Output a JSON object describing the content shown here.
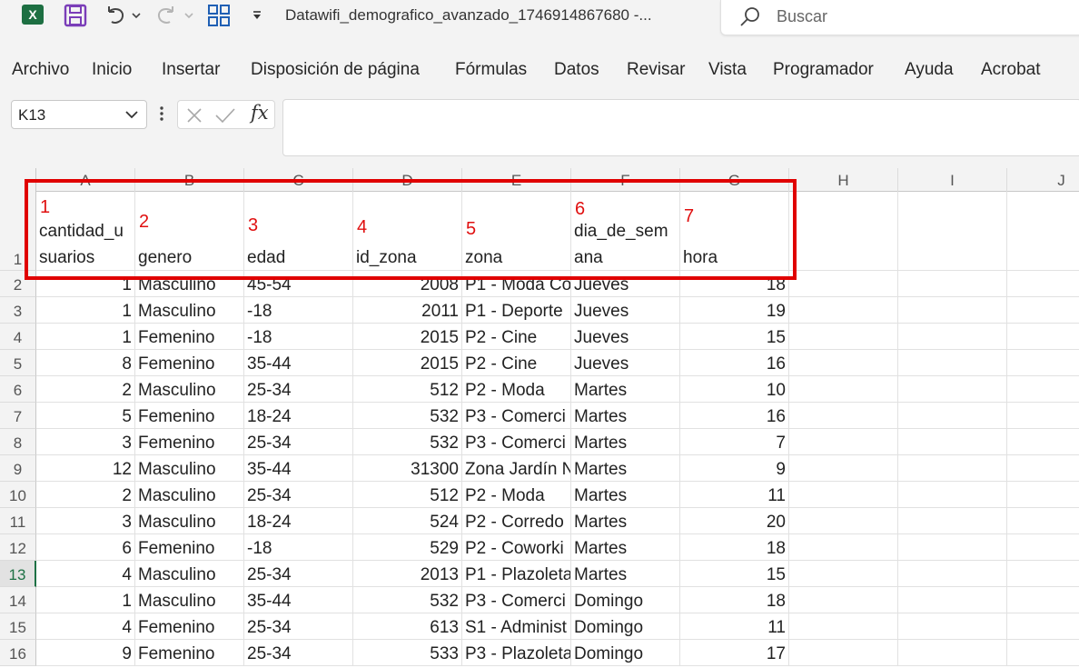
{
  "window": {
    "title": "Datawifi_demografico_avanzado_1746914867680  -...",
    "app_logo_text": "X",
    "search_placeholder": "Buscar"
  },
  "ribbon_tabs": [
    "Archivo",
    "Inicio",
    "Insertar",
    "Disposición de página",
    "Fórmulas",
    "Datos",
    "Revisar",
    "Vista",
    "Programador",
    "Ayuda",
    "Acrobat"
  ],
  "formula_bar": {
    "name_box": "K13",
    "fx_label": "fx",
    "formula": ""
  },
  "grid": {
    "columns": [
      "A",
      "B",
      "C",
      "D",
      "E",
      "F",
      "G",
      "H",
      "I",
      "J"
    ],
    "header_row": {
      "row_number": "1",
      "cells": [
        {
          "marker": "1",
          "line1": "cantidad_u",
          "line2": "suarios"
        },
        {
          "marker": "2",
          "line1": "",
          "line2": "genero"
        },
        {
          "marker": "3",
          "line1": "",
          "line2": "edad"
        },
        {
          "marker": "4",
          "line1": "",
          "line2": "id_zona"
        },
        {
          "marker": "5",
          "line1": "",
          "line2": "zona"
        },
        {
          "marker": "6",
          "line1": "dia_de_sem",
          "line2": "ana"
        },
        {
          "marker": "7",
          "line1": "",
          "line2": "hora"
        }
      ]
    },
    "rows": [
      {
        "n": "2",
        "cantidad": "1",
        "genero": "Masculino",
        "edad": "45-54",
        "id_zona": "2008",
        "zona": "P1 - Moda Co",
        "dia": "Jueves",
        "hora": "18"
      },
      {
        "n": "3",
        "cantidad": "1",
        "genero": "Masculino",
        "edad": "-18",
        "id_zona": "2011",
        "zona": "P1 - Deporte",
        "dia": "Jueves",
        "hora": "19"
      },
      {
        "n": "4",
        "cantidad": "1",
        "genero": "Femenino",
        "edad": "-18",
        "id_zona": "2015",
        "zona": "P2 - Cine",
        "dia": "Jueves",
        "hora": "15"
      },
      {
        "n": "5",
        "cantidad": "8",
        "genero": "Femenino",
        "edad": "35-44",
        "id_zona": "2015",
        "zona": "P2 - Cine",
        "dia": "Jueves",
        "hora": "16"
      },
      {
        "n": "6",
        "cantidad": "2",
        "genero": "Masculino",
        "edad": "25-34",
        "id_zona": "512",
        "zona": "P2 - Moda",
        "dia": "Martes",
        "hora": "10"
      },
      {
        "n": "7",
        "cantidad": "5",
        "genero": "Femenino",
        "edad": "18-24",
        "id_zona": "532",
        "zona": "P3 - Comerci",
        "dia": "Martes",
        "hora": "16"
      },
      {
        "n": "8",
        "cantidad": "3",
        "genero": "Femenino",
        "edad": "25-34",
        "id_zona": "532",
        "zona": "P3 - Comerci",
        "dia": "Martes",
        "hora": "7"
      },
      {
        "n": "9",
        "cantidad": "12",
        "genero": "Masculino",
        "edad": "35-44",
        "id_zona": "31300",
        "zona": "Zona Jardín N",
        "dia": "Martes",
        "hora": "9"
      },
      {
        "n": "10",
        "cantidad": "2",
        "genero": "Masculino",
        "edad": "25-34",
        "id_zona": "512",
        "zona": "P2 - Moda",
        "dia": "Martes",
        "hora": "11"
      },
      {
        "n": "11",
        "cantidad": "3",
        "genero": "Masculino",
        "edad": "18-24",
        "id_zona": "524",
        "zona": "P2 - Corredo",
        "dia": "Martes",
        "hora": "20"
      },
      {
        "n": "12",
        "cantidad": "6",
        "genero": "Femenino",
        "edad": "-18",
        "id_zona": "529",
        "zona": "P2 - Coworki",
        "dia": "Martes",
        "hora": "18"
      },
      {
        "n": "13",
        "cantidad": "4",
        "genero": "Masculino",
        "edad": "25-34",
        "id_zona": "2013",
        "zona": "P1 - Plazoleta",
        "dia": "Martes",
        "hora": "15"
      },
      {
        "n": "14",
        "cantidad": "1",
        "genero": "Masculino",
        "edad": "35-44",
        "id_zona": "532",
        "zona": "P3 - Comerci",
        "dia": "Domingo",
        "hora": "18"
      },
      {
        "n": "15",
        "cantidad": "4",
        "genero": "Femenino",
        "edad": "25-34",
        "id_zona": "613",
        "zona": "S1 - Administ",
        "dia": "Domingo",
        "hora": "11"
      },
      {
        "n": "16",
        "cantidad": "9",
        "genero": "Femenino",
        "edad": "25-34",
        "id_zona": "533",
        "zona": "P3 - Plazoleta",
        "dia": "Domingo",
        "hora": "17"
      }
    ],
    "active_row": "13"
  },
  "colors": {
    "excel_green": "#1d6f42",
    "highlight_red": "#e00000",
    "purple_save": "#7a3db8",
    "toolbar_bg": "#f3f3f3"
  },
  "icons": [
    "excel-logo-icon",
    "save-icon",
    "undo-icon",
    "redo-icon",
    "layout-icon",
    "customize-icon",
    "search-icon",
    "chevron-down-icon",
    "cancel-icon",
    "enter-icon",
    "fx-icon"
  ]
}
